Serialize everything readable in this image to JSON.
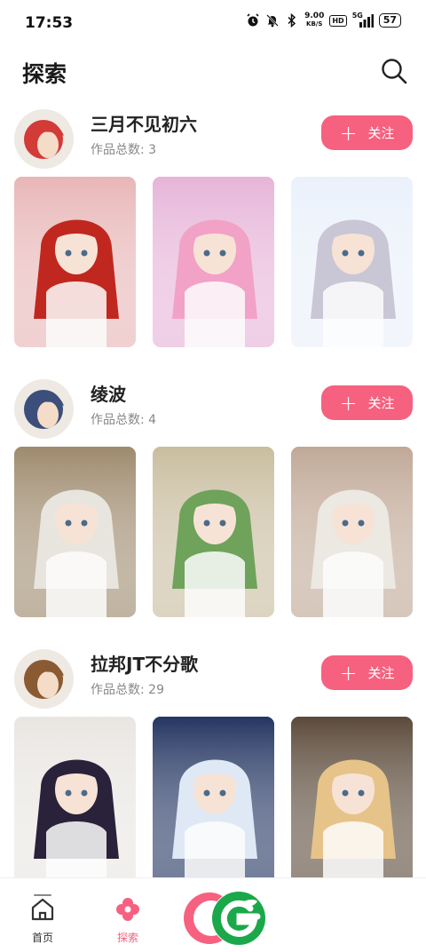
{
  "status_bar": {
    "time": "17:53",
    "net_speed": "9.00",
    "net_unit": "KB/S",
    "hd": "HD",
    "signal": "5G",
    "battery": "57"
  },
  "header": {
    "title": "探索",
    "search_icon": "search-icon"
  },
  "follow_label": "关注",
  "authors": [
    {
      "name": "三月不见初六",
      "work_count": "作品总数: 3",
      "avatar_color": "#d23b37",
      "thumbs": [
        {
          "bg": "#e8b6b7",
          "hair": "#c0281f"
        },
        {
          "bg": "#e6b4d8",
          "hair": "#f2a2c6"
        },
        {
          "bg": "#eaf1fb",
          "hair": "#c9c6d6"
        }
      ]
    },
    {
      "name": "绫波",
      "work_count": "作品总数: 4",
      "avatar_color": "#3b4f7a",
      "thumbs": [
        {
          "bg": "#9e8a6d",
          "hair": "#e8e5de"
        },
        {
          "bg": "#c9bd9f",
          "hair": "#6fa25a"
        },
        {
          "bg": "#c0a896",
          "hair": "#ece8e2"
        }
      ]
    },
    {
      "name": "拉邦JT不分歌",
      "work_count": "作品总数: 29",
      "avatar_color": "#8a5a32",
      "thumbs": [
        {
          "bg": "#e9e6e2",
          "hair": "#2a223a"
        },
        {
          "bg": "#233561",
          "hair": "#dfe9f6"
        },
        {
          "bg": "#5b4a3a",
          "hair": "#e6c489"
        }
      ]
    }
  ],
  "nav": {
    "home": "首页",
    "explore": "探索"
  },
  "colors": {
    "accent": "#f6617f",
    "logo_green": "#1aa84a"
  }
}
